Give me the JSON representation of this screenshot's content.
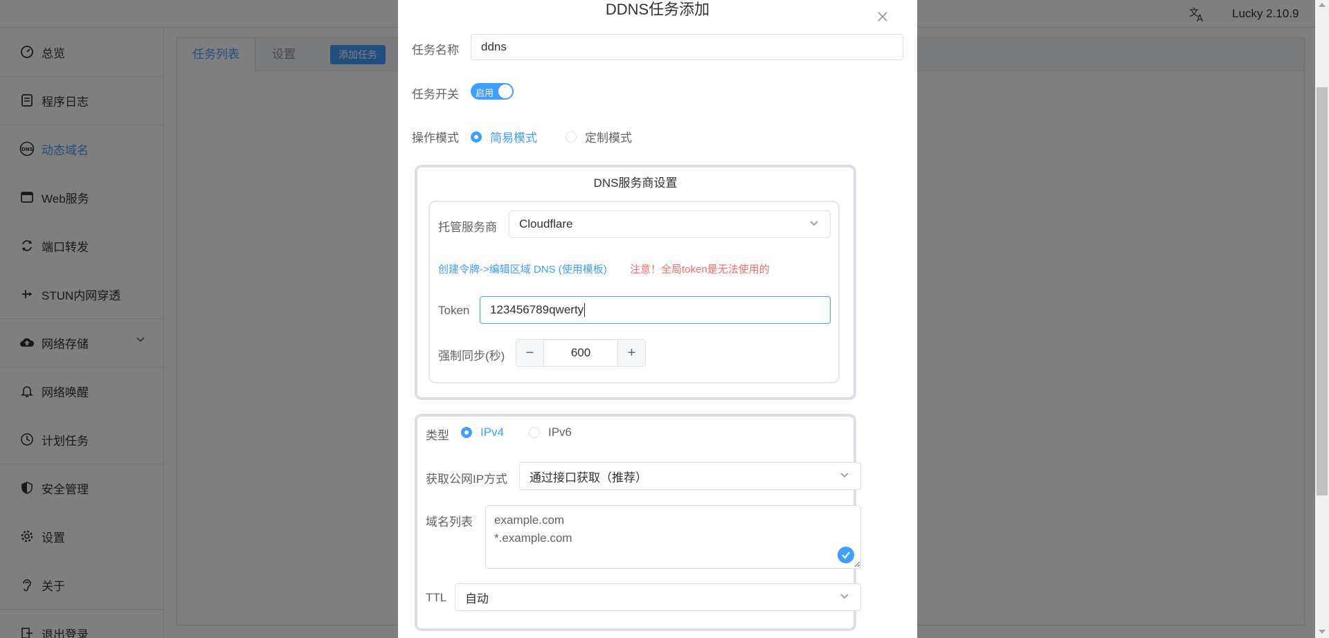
{
  "topbar": {
    "version": "Lucky 2.10.9"
  },
  "sidebar": {
    "items": [
      {
        "label": "总览",
        "icon": "dashboard-icon"
      },
      {
        "label": "程序日志",
        "icon": "log-icon"
      },
      {
        "label": "动态域名",
        "icon": "dns-icon",
        "active": true
      },
      {
        "label": "Web服务",
        "icon": "web-icon"
      },
      {
        "label": "端口转发",
        "icon": "port-forward-icon"
      },
      {
        "label": "STUN内网穿透",
        "icon": "stun-icon"
      },
      {
        "label": "网络存储",
        "icon": "cloud-storage-icon"
      },
      {
        "label": "网络唤醒",
        "icon": "bell-icon"
      },
      {
        "label": "计划任务",
        "icon": "clock-icon"
      },
      {
        "label": "安全管理",
        "icon": "shield-icon"
      },
      {
        "label": "设置",
        "icon": "gear-icon"
      },
      {
        "label": "关于",
        "icon": "ear-icon"
      },
      {
        "label": "退出登录",
        "icon": "logout-icon"
      }
    ]
  },
  "main": {
    "tabs": [
      {
        "label": "任务列表",
        "active": true
      },
      {
        "label": "设置"
      }
    ],
    "add_task": "添加任务"
  },
  "dialog": {
    "title": "DDNS任务添加",
    "task_name": {
      "label": "任务名称",
      "value": "ddns"
    },
    "task_switch": {
      "label": "任务开关",
      "text": "启用",
      "on": true
    },
    "mode": {
      "label": "操作模式",
      "options": [
        "简易模式",
        "定制模式"
      ],
      "selected": "简易模式"
    },
    "dns_settings": {
      "title": "DNS服务商设置",
      "provider": {
        "label": "托管服务商",
        "value": "Cloudflare"
      },
      "token_link": "创建令牌->编辑区域 DNS (使用模板)",
      "token_warning": "注意！全局token是无法使用的",
      "token": {
        "label": "Token",
        "value": "123456789qwerty"
      },
      "force_sync": {
        "label": "强制同步(秒)",
        "value": "600",
        "minus": "−",
        "plus": "+"
      }
    },
    "record": {
      "type": {
        "label": "类型",
        "options": [
          "IPv4",
          "IPv6"
        ],
        "selected": "IPv4"
      },
      "ip_method": {
        "label": "获取公网IP方式",
        "value": "通过接口获取（推荐）"
      },
      "domains": {
        "label": "域名列表",
        "lines": [
          "example.com",
          "*.example.com"
        ]
      },
      "ttl": {
        "label": "TTL",
        "value": "自动"
      }
    }
  },
  "colors": {
    "accent": "#409eff",
    "warning": "#f56c6c",
    "overlay": "rgba(0,0,0,0.5)"
  }
}
